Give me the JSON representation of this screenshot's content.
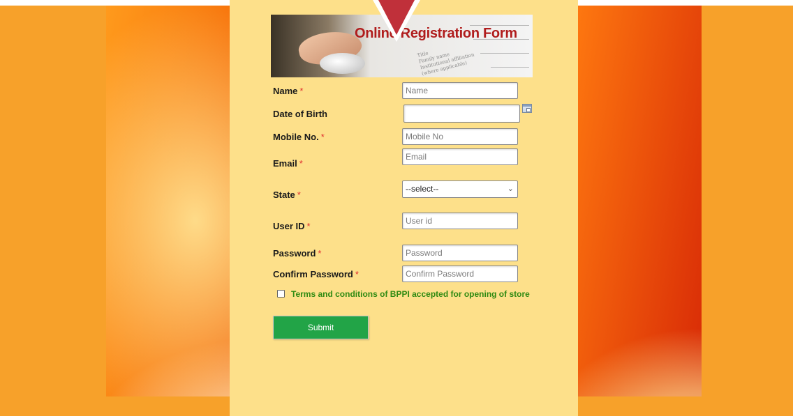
{
  "banner": {
    "title": "Online Registration Form",
    "paper_lines": [
      "Title",
      "Family name",
      "Institutional affiliation",
      "(where applicable)"
    ]
  },
  "form": {
    "name": {
      "label": "Name",
      "required": "*",
      "placeholder": "Name",
      "value": ""
    },
    "dob": {
      "label": "Date of Birth",
      "value": ""
    },
    "mobile": {
      "label": "Mobile No.",
      "required": "*",
      "placeholder": "Mobile No",
      "value": ""
    },
    "email": {
      "label": "Email",
      "required": "*",
      "placeholder": "Email",
      "value": ""
    },
    "state": {
      "label": "State",
      "required": "*",
      "selected": "--select--"
    },
    "user_id": {
      "label": "User ID",
      "required": "*",
      "placeholder": "User id",
      "value": ""
    },
    "password": {
      "label": "Password",
      "required": "*",
      "placeholder": "Password"
    },
    "confirm_password": {
      "label": "Confirm Password",
      "required": "*",
      "placeholder": "Confirm Password"
    },
    "terms": {
      "label": "Terms and conditions of BPPI accepted for opening of store",
      "checked": false
    },
    "submit_label": "Submit"
  },
  "colors": {
    "panel": "#fde08a",
    "submit": "#22a447",
    "terms_text": "#2f8a12",
    "required": "#e03030",
    "banner_title": "#b01c1c"
  },
  "icons": [
    "calendar-icon",
    "chevron-down-icon",
    "pin-arrow-icon"
  ]
}
